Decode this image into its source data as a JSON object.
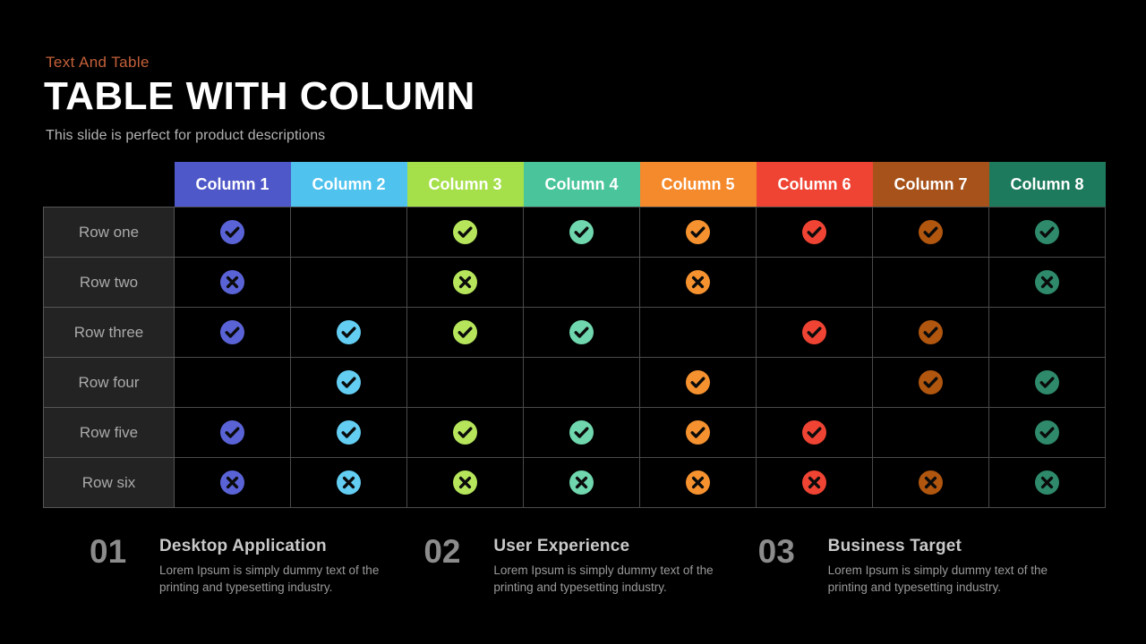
{
  "header": {
    "eyebrow": "Text And Table",
    "eyebrow_color": "#c4603a",
    "title": "TABLE WITH COLUMN",
    "subtitle": "This slide is perfect for product descriptions"
  },
  "table": {
    "corner_label": "",
    "columns": [
      {
        "label": "Column 1",
        "color": "#4f58c8"
      },
      {
        "label": "Column 2",
        "color": "#4fc3ee"
      },
      {
        "label": "Column 3",
        "color": "#a5e04a"
      },
      {
        "label": "Column 4",
        "color": "#49c49b"
      },
      {
        "label": "Column 5",
        "color": "#f58a2c"
      },
      {
        "label": "Column 6",
        "color": "#ef4433"
      },
      {
        "label": "Column 7",
        "color": "#a6521a"
      },
      {
        "label": "Column 8",
        "color": "#1d7a5c"
      }
    ],
    "row_labels": [
      "Row one",
      "Row two",
      "Row three",
      "Row four",
      "Row five",
      "Row six"
    ],
    "icon_colors": [
      "#5a63d6",
      "#63cdf2",
      "#b6e55c",
      "#6fd6ae",
      "#f5922f",
      "#ef4433",
      "#b0560f",
      "#2e8a6b"
    ],
    "cells": [
      [
        "check",
        "none",
        "check",
        "check",
        "check",
        "check",
        "check",
        "check"
      ],
      [
        "cross",
        "none",
        "cross",
        "none",
        "cross",
        "none",
        "none",
        "cross"
      ],
      [
        "check",
        "check",
        "check",
        "check",
        "none",
        "check",
        "check",
        "none"
      ],
      [
        "none",
        "check",
        "none",
        "none",
        "check",
        "none",
        "check",
        "check"
      ],
      [
        "check",
        "check",
        "check",
        "check",
        "check",
        "check",
        "none",
        "check"
      ],
      [
        "cross",
        "cross",
        "cross",
        "cross",
        "cross",
        "cross",
        "cross",
        "cross"
      ]
    ],
    "icon_names": {
      "check": "check-circle-icon",
      "cross": "cross-circle-icon"
    }
  },
  "features": [
    {
      "number": "01",
      "title": "Desktop Application",
      "description": "Lorem Ipsum is simply dummy text of the printing and typesetting industry."
    },
    {
      "number": "02",
      "title": "User Experience",
      "description": "Lorem Ipsum is simply dummy text of the printing and typesetting industry."
    },
    {
      "number": "03",
      "title": "Business Target",
      "description": "Lorem Ipsum is simply dummy text of the printing and typesetting industry."
    }
  ]
}
